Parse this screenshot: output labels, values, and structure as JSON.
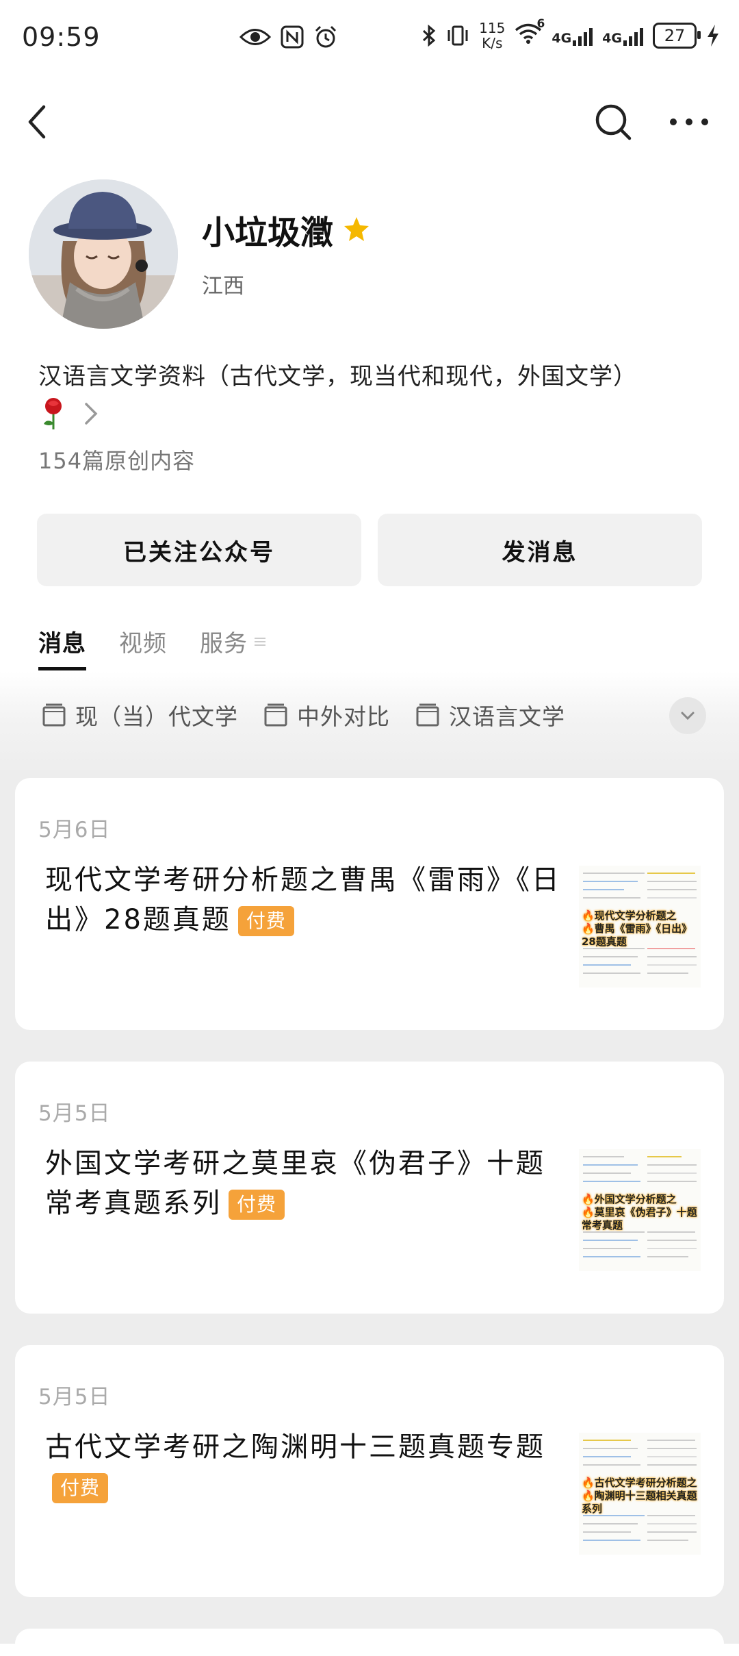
{
  "status_bar": {
    "time": "09:59",
    "speed_value": "115",
    "speed_unit": "K/s",
    "wifi_badge": "6",
    "network_1": "4G",
    "network_2": "4G",
    "battery": "27"
  },
  "nav": {
    "back_icon": "chevron-left-icon",
    "search_icon": "search-icon",
    "more_icon": "more-horizontal-icon"
  },
  "profile": {
    "name": "小垃圾瀓",
    "location": "江西",
    "description": "汉语言文学资料（古代文学，现当代和现代，外国文学）",
    "article_count": "154篇原创内容"
  },
  "buttons": {
    "follow": "已关注公众号",
    "message": "发消息"
  },
  "tabs": [
    {
      "label": "消息",
      "active": true
    },
    {
      "label": "视频",
      "active": false
    },
    {
      "label": "服务",
      "active": false
    }
  ],
  "categories": [
    {
      "label": "现（当）代文学"
    },
    {
      "label": "中外对比"
    },
    {
      "label": "汉语言文学"
    }
  ],
  "articles": [
    {
      "date": "5月6日",
      "title": "现代文学考研分析题之曹禺《雷雨》《日出》28题真题",
      "badge": "付费",
      "thumb_caption": "🔥现代文学分析题之\n🔥曹禺《雷雨》《日出》28题真题"
    },
    {
      "date": "5月5日",
      "title": "外国文学考研之莫里哀《伪君子》十题常考真题系列",
      "badge": "付费",
      "thumb_caption": "🔥外国文学分析题之\n🔥莫里哀《伪君子》十题常考真题"
    },
    {
      "date": "5月5日",
      "title": "古代文学考研之陶渊明十三题真题专题",
      "badge": "付费",
      "thumb_caption": "🔥古代文学考研分析题之\n🔥陶渊明十三题相关真题系列"
    }
  ],
  "colors": {
    "paid_badge": "#f5a23a",
    "star": "#f5b800",
    "page_bg": "#ededed"
  }
}
